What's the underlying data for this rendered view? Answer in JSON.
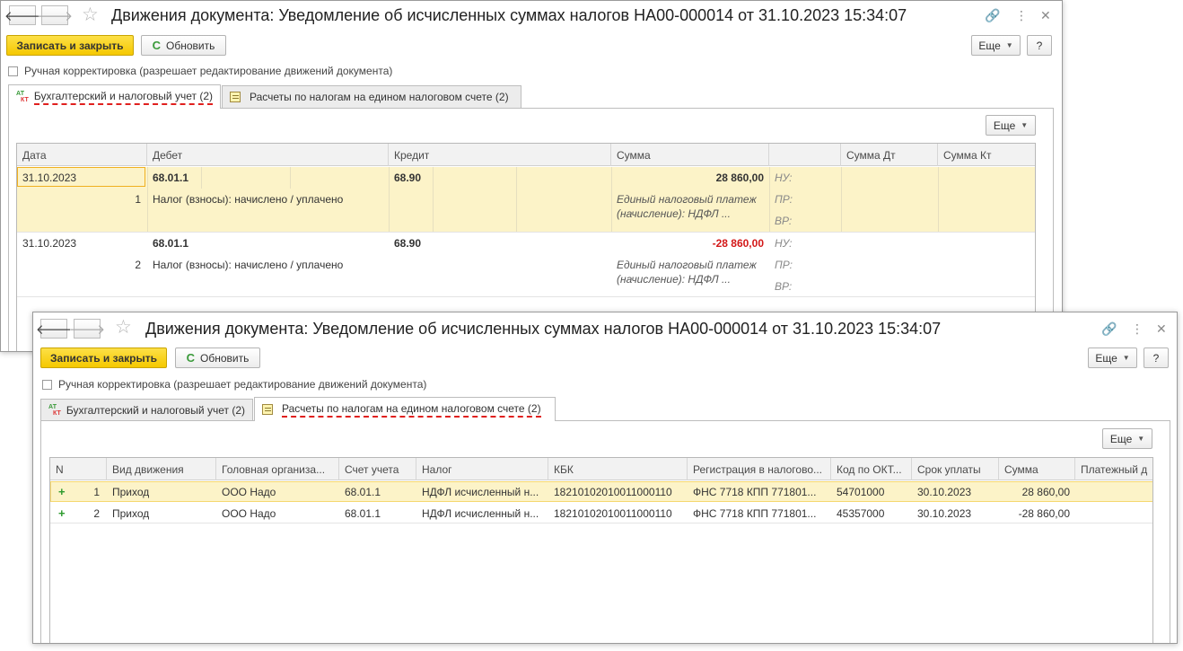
{
  "colors": {
    "accent_yellow": "#f5c800",
    "selected_row": "#fcf3c8",
    "negative": "#d31818",
    "dashed_underline": "#e0201e"
  },
  "window1": {
    "title": "Движения документа: Уведомление об исчисленных суммах налогов НА00-000014 от 31.10.2023 15:34:07",
    "nav_back": "🡐",
    "nav_forward": "🡒",
    "star": "☆",
    "link_icon": "🔗",
    "more_icon": "⋮",
    "close_icon": "✕",
    "save_close": "Записать и закрыть",
    "refresh": "Обновить",
    "refresh_icon": "C",
    "more": "Еще",
    "help": "?",
    "manual_edit": "Ручная корректировка (разрешает редактирование движений документа)",
    "tabs": [
      {
        "label": "Бухгалтерский и налоговый учет (2)"
      },
      {
        "label": "Расчеты по налогам на едином налоговом счете (2)"
      }
    ],
    "table_more": "Еще",
    "columns": [
      "Дата",
      "Дебет",
      "Кредит",
      "Сумма",
      "",
      "Сумма Дт",
      "Сумма Кт"
    ],
    "entries": [
      {
        "date": "31.10.2023",
        "num": "1",
        "debit": "68.01.1",
        "debit_sub": "Налог (взносы): начислено / уплачено",
        "credit": "68.90",
        "sum": "28 860,00",
        "desc1": "Единый налоговый платеж",
        "desc2": "(начисление): НДФЛ ...",
        "nu": "НУ:",
        "pr": "ПР:",
        "vr": "ВР:"
      },
      {
        "date": "31.10.2023",
        "num": "2",
        "debit": "68.01.1",
        "debit_sub": "Налог (взносы): начислено / уплачено",
        "credit": "68.90",
        "sum": "-28 860,00",
        "desc1": "Единый налоговый платеж",
        "desc2": "(начисление): НДФЛ ...",
        "nu": "НУ:",
        "pr": "ПР:",
        "vr": "ВР:"
      }
    ]
  },
  "window2": {
    "title": "Движения документа: Уведомление об исчисленных суммах налогов НА00-000014 от 31.10.2023 15:34:07",
    "nav_back": "🡐",
    "nav_forward": "🡒",
    "star": "☆",
    "link_icon": "🔗",
    "more_icon": "⋮",
    "close_icon": "✕",
    "save_close": "Записать и закрыть",
    "refresh": "Обновить",
    "refresh_icon": "C",
    "more": "Еще",
    "help": "?",
    "manual_edit": "Ручная корректировка (разрешает редактирование движений документа)",
    "tabs": [
      {
        "label": "Бухгалтерский и налоговый учет (2)"
      },
      {
        "label": "Расчеты по налогам на едином налоговом счете (2)"
      }
    ],
    "table_more": "Еще",
    "columns": [
      "N",
      "Вид движения",
      "Головная организа...",
      "Счет учета",
      "Налог",
      "КБК",
      "Регистрация в налогово...",
      "Код по ОКТ...",
      "Срок уплаты",
      "Сумма",
      "Платежный д"
    ],
    "rows": [
      {
        "icon": "+",
        "n": "1",
        "kind": "Приход",
        "org": "ООО Надо",
        "account": "68.01.1",
        "tax": "НДФЛ исчисленный н...",
        "kbk": "18210102010011000110",
        "reg": "ФНС 7718 КПП 771801...",
        "oktmo": "54701000",
        "due": "30.10.2023",
        "sum": "28 860,00"
      },
      {
        "icon": "+",
        "n": "2",
        "kind": "Приход",
        "org": "ООО Надо",
        "account": "68.01.1",
        "tax": "НДФЛ исчисленный н...",
        "kbk": "18210102010011000110",
        "reg": "ФНС 7718 КПП 771801...",
        "oktmo": "45357000",
        "due": "30.10.2023",
        "sum": "-28 860,00"
      }
    ]
  }
}
